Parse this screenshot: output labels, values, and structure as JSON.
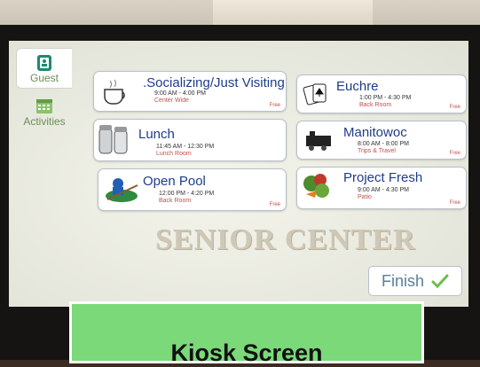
{
  "sidebar": {
    "tabs": [
      {
        "label": "Guest",
        "icon": "person-card-icon",
        "active": true
      },
      {
        "label": "Activities",
        "icon": "calendar-icon",
        "active": false
      }
    ]
  },
  "watermark": "SENIOR CENTER",
  "activities": [
    {
      "title": ".Socializing/Just Visiting",
      "time": "9:00 AM - 4:00 PM",
      "location": "Center Wide",
      "price": "Free",
      "icon": "coffee-cup-icon"
    },
    {
      "title": "Euchre",
      "time": "1:00 PM - 4:30 PM",
      "location": "Back Room",
      "price": "Free",
      "icon": "playing-cards-icon"
    },
    {
      "title": "Lunch",
      "time": "11:45 AM - 12:30 PM",
      "location": "Lunch Room",
      "price": "",
      "icon": "salt-pepper-icon"
    },
    {
      "title": "Manitowoc",
      "time": "8:00 AM - 8:00 PM",
      "location": "Trips & Travel",
      "price": "Free",
      "icon": "train-icon"
    },
    {
      "title": "Open Pool",
      "time": "12:00 PM - 4:20 PM",
      "location": "Back Room",
      "price": "Free",
      "icon": "pool-table-icon"
    },
    {
      "title": "Project Fresh",
      "time": "9:00 AM - 4:30 PM",
      "location": "Patio",
      "price": "Free",
      "icon": "vegetables-icon"
    }
  ],
  "finish": {
    "label": "Finish",
    "icon": "checkmark-icon"
  },
  "caption": "Kiosk Screen",
  "colors": {
    "accent": "#1f3c8a",
    "location": "#c0504d",
    "sidebar": "#6c8e5a",
    "caption_bg": "#7bd97a"
  }
}
